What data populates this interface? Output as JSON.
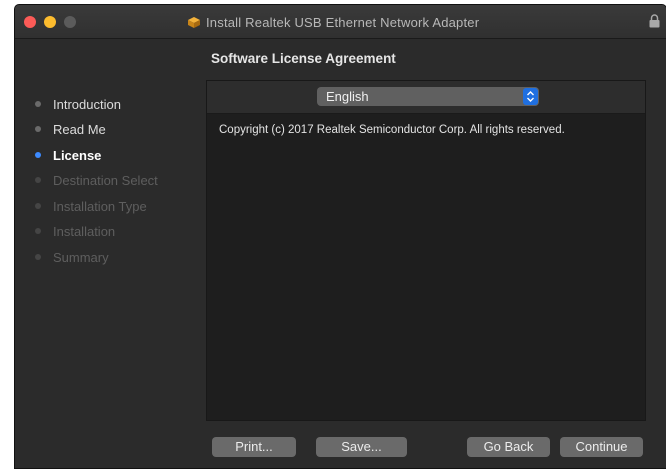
{
  "window": {
    "title": "Install Realtek USB Ethernet Network Adapter"
  },
  "page": {
    "heading": "Software License Agreement"
  },
  "sidebar": {
    "items": [
      {
        "label": "Introduction",
        "state": "done"
      },
      {
        "label": "Read Me",
        "state": "done"
      },
      {
        "label": "License",
        "state": "active"
      },
      {
        "label": "Destination Select",
        "state": "future"
      },
      {
        "label": "Installation Type",
        "state": "future"
      },
      {
        "label": "Installation",
        "state": "future"
      },
      {
        "label": "Summary",
        "state": "future"
      }
    ]
  },
  "language": {
    "selected": "English"
  },
  "license": {
    "text": "Copyright (c) 2017 Realtek Semiconductor Corp.  All rights reserved."
  },
  "buttons": {
    "print": "Print...",
    "save": "Save...",
    "go_back": "Go Back",
    "continue": "Continue"
  },
  "colors": {
    "window_bg": "#2b2b2b",
    "panel_bg": "#1e1e1e",
    "accent": "#3d8bff",
    "close": "#fc5b57",
    "minimize": "#fdbc2e"
  },
  "icons": [
    "close-button",
    "minimize-button",
    "zoom-button",
    "package-icon",
    "lock-icon",
    "popup-arrows-icon"
  ]
}
